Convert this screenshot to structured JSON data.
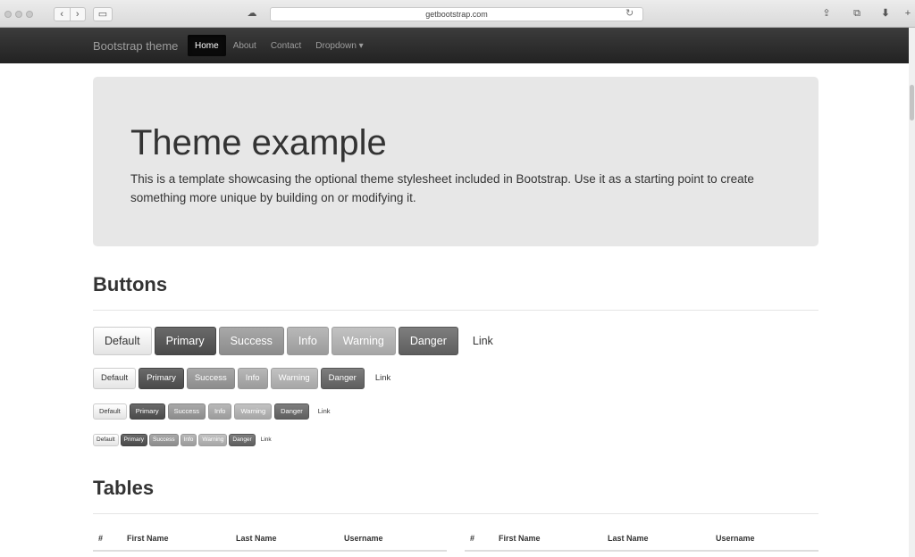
{
  "browser": {
    "url": "getbootstrap.com",
    "icons": [
      "back-icon",
      "forward-icon",
      "sidebar-icon",
      "cloud-icon",
      "reload-icon",
      "share-icon",
      "tabs-icon",
      "download-icon",
      "new-tab-icon"
    ]
  },
  "navbar": {
    "brand": "Bootstrap theme",
    "links": [
      "Home",
      "About",
      "Contact",
      "Dropdown ▾"
    ],
    "active": "Home"
  },
  "jumbotron": {
    "title": "Theme example",
    "text": "This is a template showcasing the optional theme stylesheet included in Bootstrap. Use it as a starting point to create something more unique by building on or modifying it."
  },
  "buttons_section": {
    "title": "Buttons",
    "labels": {
      "default": "Default",
      "primary": "Primary",
      "success": "Success",
      "info": "Info",
      "warning": "Warning",
      "danger": "Danger",
      "link": "Link"
    }
  },
  "tables_section": {
    "title": "Tables",
    "headers": [
      "#",
      "First Name",
      "Last Name",
      "Username"
    ]
  }
}
